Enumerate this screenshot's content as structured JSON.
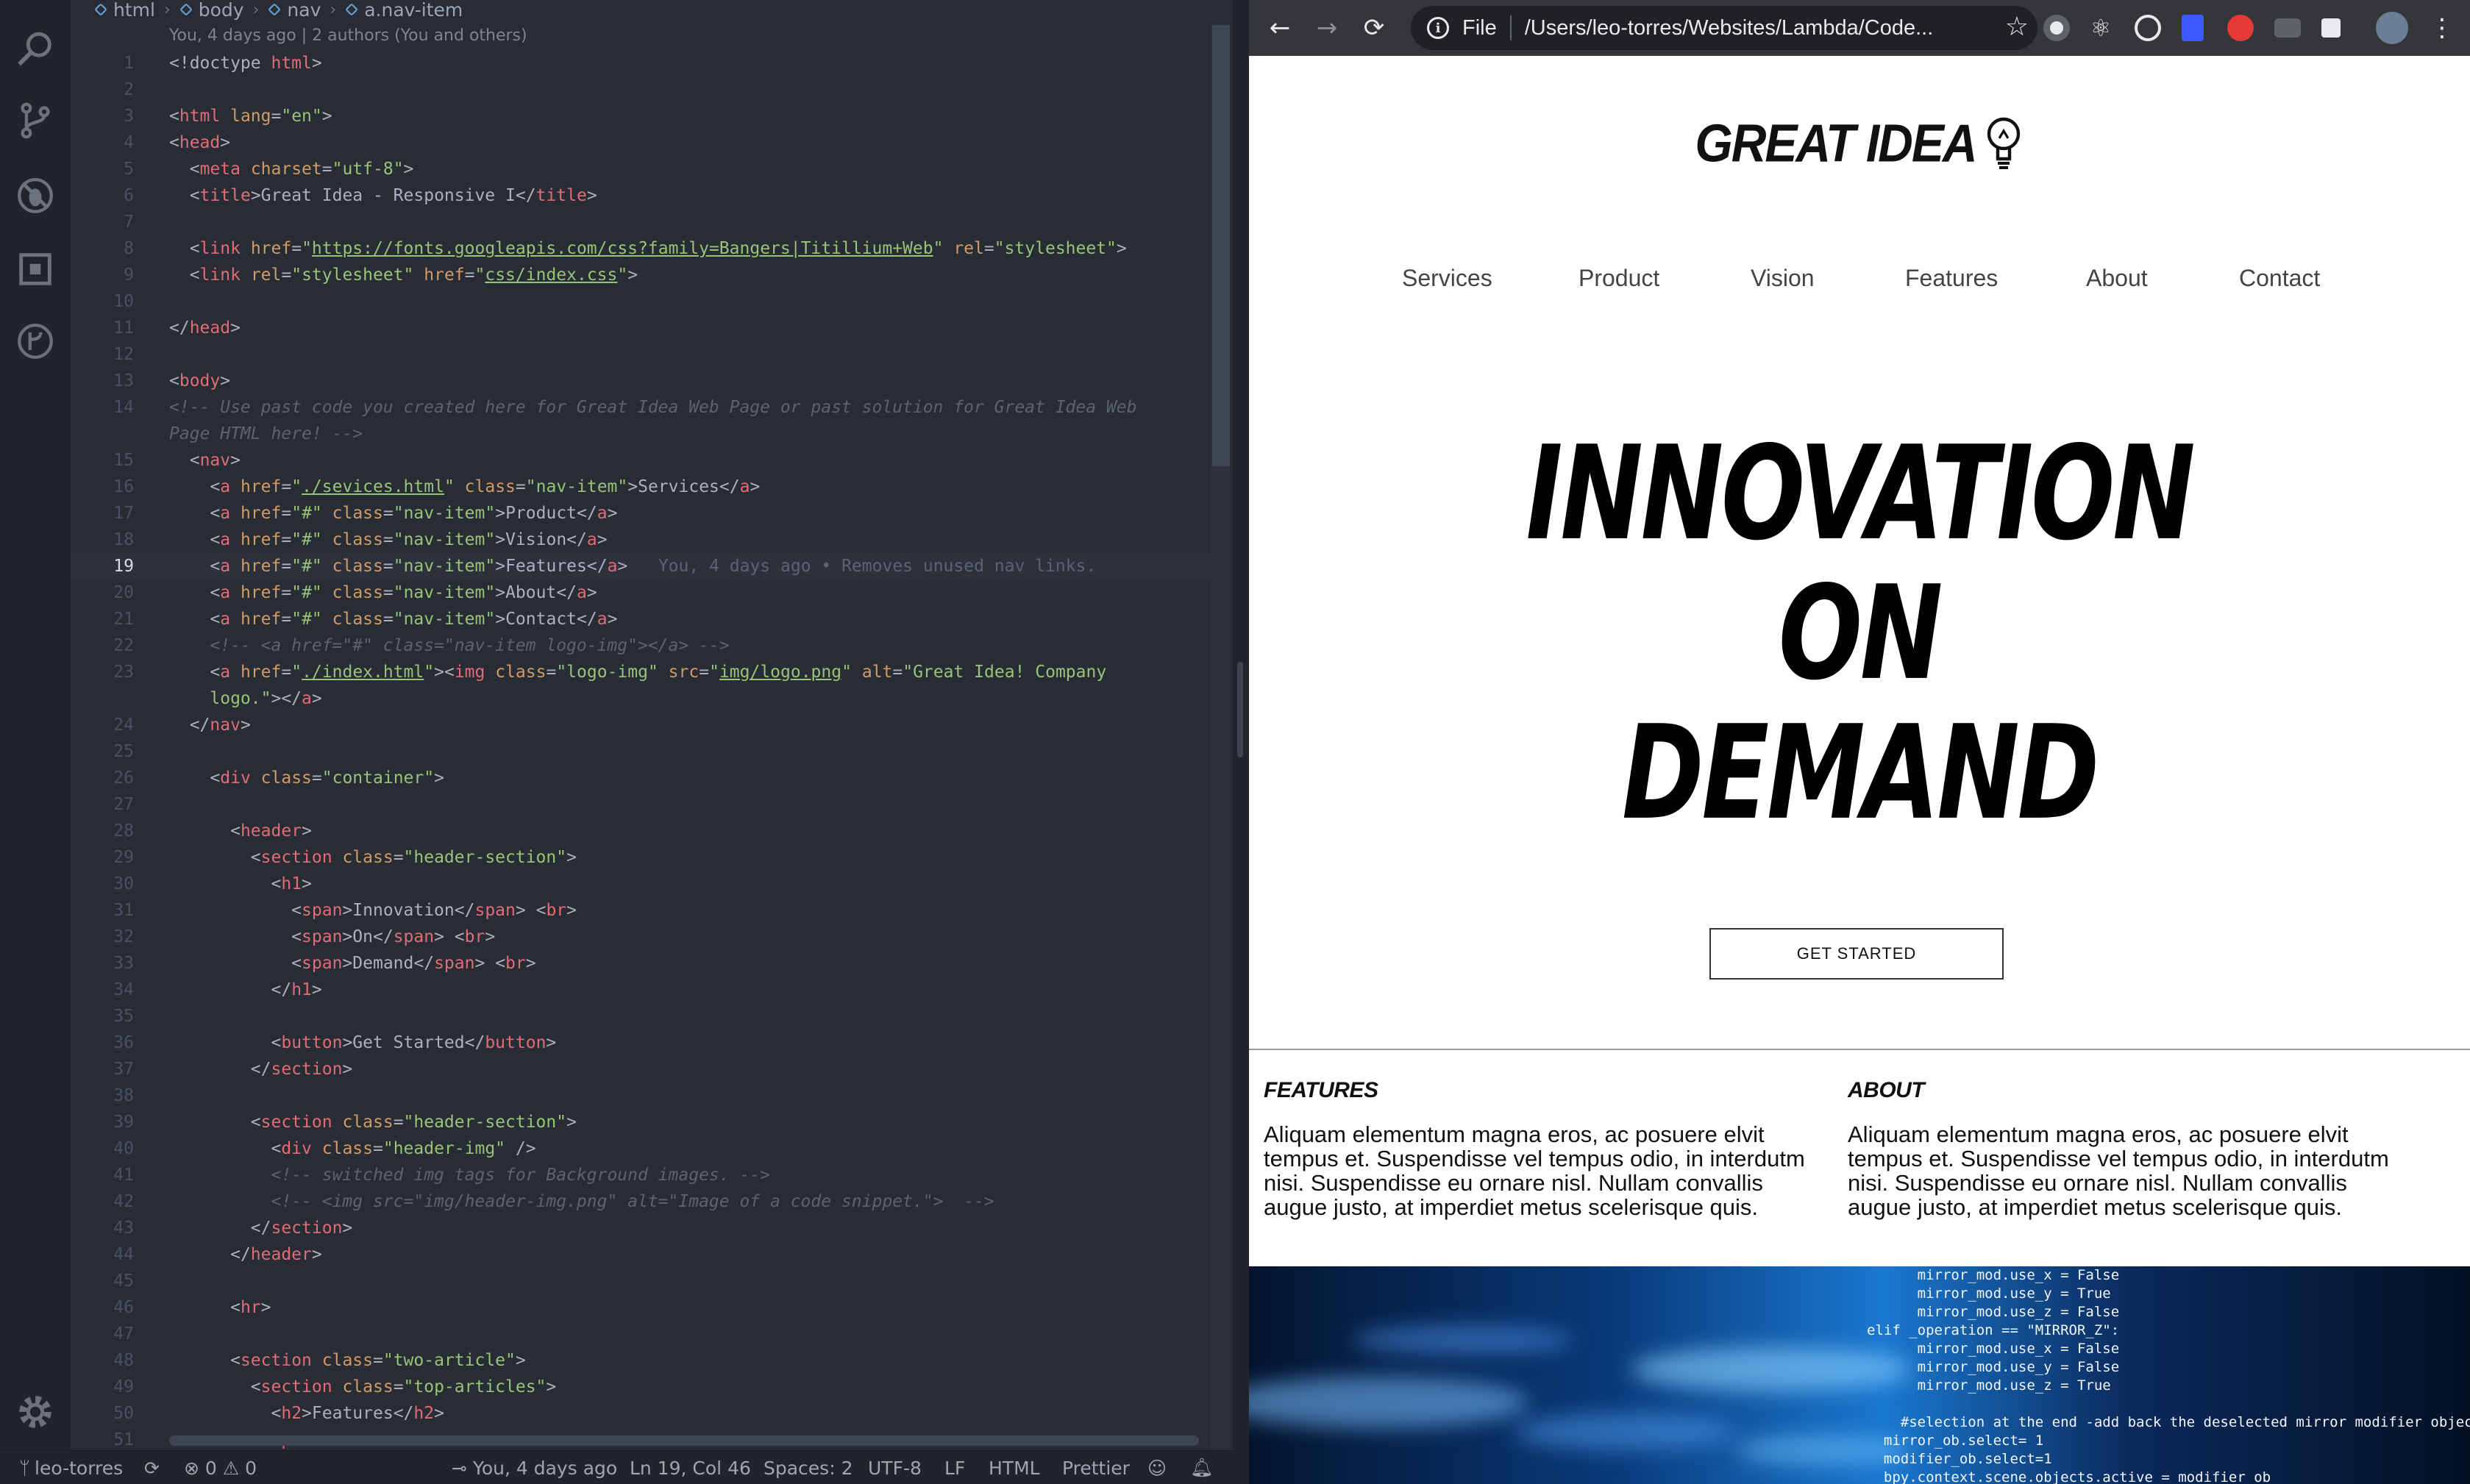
{
  "editor": {
    "breadcrumb": [
      "html",
      "body",
      "nav",
      "a.nav-item"
    ],
    "blame_header": "You, 4 days ago | 2 authors (You and others)",
    "inline_blame": "You, 4 days ago • Removes unused nav links.",
    "current_line": 19,
    "lines": [
      {
        "n": "1",
        "html": "<span class='t-pun'>&lt;!doctype </span><span class='t-tag'>html</span><span class='t-pun'>&gt;</span>"
      },
      {
        "n": "2",
        "html": ""
      },
      {
        "n": "3",
        "html": "<span class='t-pun'>&lt;</span><span class='t-tag'>html</span> <span class='t-attr'>lang</span>=<span class='t-str'>\"en\"</span><span class='t-pun'>&gt;</span>"
      },
      {
        "n": "4",
        "html": "<span class='t-pun'>&lt;</span><span class='t-tag'>head</span><span class='t-pun'>&gt;</span>"
      },
      {
        "n": "5",
        "html": "  <span class='t-pun'>&lt;</span><span class='t-tag'>meta</span> <span class='t-attr'>charset</span>=<span class='t-str'>\"utf-8\"</span><span class='t-pun'>&gt;</span>"
      },
      {
        "n": "6",
        "html": "  <span class='t-pun'>&lt;</span><span class='t-tag'>title</span><span class='t-pun'>&gt;</span>Great Idea - Responsive I<span class='t-pun'>&lt;/</span><span class='t-tag'>title</span><span class='t-pun'>&gt;</span>"
      },
      {
        "n": "7",
        "html": ""
      },
      {
        "n": "8",
        "html": "  <span class='t-pun'>&lt;</span><span class='t-tag'>link</span> <span class='t-attr'>href</span>=<span class='t-str'>\"</span><span class='t-link'>https://fonts.googleapis.com/css?family=Bangers|Titillium+Web</span><span class='t-str'>\"</span> <span class='t-attr'>rel</span>=<span class='t-str'>\"stylesheet\"</span><span class='t-pun'>&gt;</span>"
      },
      {
        "n": "9",
        "html": "  <span class='t-pun'>&lt;</span><span class='t-tag'>link</span> <span class='t-attr'>rel</span>=<span class='t-str'>\"stylesheet\"</span> <span class='t-attr'>href</span>=<span class='t-str'>\"</span><span class='t-link'>css/index.css</span><span class='t-str'>\"</span><span class='t-pun'>&gt;</span>"
      },
      {
        "n": "10",
        "html": ""
      },
      {
        "n": "11",
        "html": "<span class='t-pun'>&lt;/</span><span class='t-tag'>head</span><span class='t-pun'>&gt;</span>"
      },
      {
        "n": "12",
        "html": ""
      },
      {
        "n": "13",
        "html": "<span class='t-pun'>&lt;</span><span class='t-tag'>body</span><span class='t-pun'>&gt;</span>"
      },
      {
        "n": "14",
        "html": "<span class='t-com'>&lt;!-- Use past code you created here for Great Idea Web Page or past solution for Great Idea Web</span>"
      },
      {
        "n": "",
        "html": "<span class='t-com'>Page HTML here! --&gt;</span>"
      },
      {
        "n": "15",
        "html": "  <span class='t-pun'>&lt;</span><span class='t-tag'>nav</span><span class='t-pun'>&gt;</span>"
      },
      {
        "n": "16",
        "html": "    <span class='t-pun'>&lt;</span><span class='t-tag'>a</span> <span class='t-attr'>href</span>=<span class='t-str'>\"</span><span class='t-link'>./sevices.html</span><span class='t-str'>\"</span> <span class='t-attr'>class</span>=<span class='t-str'>\"nav-item\"</span><span class='t-pun'>&gt;</span>Services<span class='t-pun'>&lt;/</span><span class='t-tag'>a</span><span class='t-pun'>&gt;</span>"
      },
      {
        "n": "17",
        "html": "    <span class='t-pun'>&lt;</span><span class='t-tag'>a</span> <span class='t-attr'>href</span>=<span class='t-str'>\"#\"</span> <span class='t-attr'>class</span>=<span class='t-str'>\"nav-item\"</span><span class='t-pun'>&gt;</span>Product<span class='t-pun'>&lt;/</span><span class='t-tag'>a</span><span class='t-pun'>&gt;</span>"
      },
      {
        "n": "18",
        "html": "    <span class='t-pun'>&lt;</span><span class='t-tag'>a</span> <span class='t-attr'>href</span>=<span class='t-str'>\"#\"</span> <span class='t-attr'>class</span>=<span class='t-str'>\"nav-item\"</span><span class='t-pun'>&gt;</span>Vision<span class='t-pun'>&lt;/</span><span class='t-tag'>a</span><span class='t-pun'>&gt;</span>"
      },
      {
        "n": "19",
        "html": "    <span class='t-pun'>&lt;</span><span class='t-tag'>a</span> <span class='t-attr'>href</span>=<span class='t-str'>\"#\"</span> <span class='t-attr'>class</span>=<span class='t-str'>\"nav-item\"</span><span class='t-pun'>&gt;</span>Features<span class='t-pun'>&lt;/</span><span class='t-tag'>a</span><span class='t-pun'>&gt;</span>   <span class='blame-inline'>You, 4 days ago • Removes unused nav links.</span>"
      },
      {
        "n": "20",
        "html": "    <span class='t-pun'>&lt;</span><span class='t-tag'>a</span> <span class='t-attr'>href</span>=<span class='t-str'>\"#\"</span> <span class='t-attr'>class</span>=<span class='t-str'>\"nav-item\"</span><span class='t-pun'>&gt;</span>About<span class='t-pun'>&lt;/</span><span class='t-tag'>a</span><span class='t-pun'>&gt;</span>"
      },
      {
        "n": "21",
        "html": "    <span class='t-pun'>&lt;</span><span class='t-tag'>a</span> <span class='t-attr'>href</span>=<span class='t-str'>\"#\"</span> <span class='t-attr'>class</span>=<span class='t-str'>\"nav-item\"</span><span class='t-pun'>&gt;</span>Contact<span class='t-pun'>&lt;/</span><span class='t-tag'>a</span><span class='t-pun'>&gt;</span>"
      },
      {
        "n": "22",
        "html": "    <span class='t-com'>&lt;!-- &lt;a href=\"#\" class=\"nav-item logo-img\"&gt;&lt;/a&gt; --&gt;</span>"
      },
      {
        "n": "23",
        "html": "    <span class='t-pun'>&lt;</span><span class='t-tag'>a</span> <span class='t-attr'>href</span>=<span class='t-str'>\"</span><span class='t-link'>./index.html</span><span class='t-str'>\"</span><span class='t-pun'>&gt;&lt;</span><span class='t-tag'>img</span> <span class='t-attr'>class</span>=<span class='t-str'>\"logo-img\"</span> <span class='t-attr'>src</span>=<span class='t-str'>\"</span><span class='t-link'>img/logo.png</span><span class='t-str'>\"</span> <span class='t-attr'>alt</span>=<span class='t-str'>\"Great Idea! Company</span>"
      },
      {
        "n": "",
        "html": "    <span class='t-str'>logo.\"</span><span class='t-pun'>&gt;&lt;/</span><span class='t-tag'>a</span><span class='t-pun'>&gt;</span>"
      },
      {
        "n": "24",
        "html": "  <span class='t-pun'>&lt;/</span><span class='t-tag'>nav</span><span class='t-pun'>&gt;</span>"
      },
      {
        "n": "25",
        "html": ""
      },
      {
        "n": "26",
        "html": "    <span class='t-pun'>&lt;</span><span class='t-tag'>div</span> <span class='t-attr'>class</span>=<span class='t-str'>\"container\"</span><span class='t-pun'>&gt;</span>"
      },
      {
        "n": "27",
        "html": ""
      },
      {
        "n": "28",
        "html": "      <span class='t-pun'>&lt;</span><span class='t-tag'>header</span><span class='t-pun'>&gt;</span>"
      },
      {
        "n": "29",
        "html": "        <span class='t-pun'>&lt;</span><span class='t-tag'>section</span> <span class='t-attr'>class</span>=<span class='t-str'>\"header-section\"</span><span class='t-pun'>&gt;</span>"
      },
      {
        "n": "30",
        "html": "          <span class='t-pun'>&lt;</span><span class='t-tag'>h1</span><span class='t-pun'>&gt;</span>"
      },
      {
        "n": "31",
        "html": "            <span class='t-pun'>&lt;</span><span class='t-tag'>span</span><span class='t-pun'>&gt;</span>Innovation<span class='t-pun'>&lt;/</span><span class='t-tag'>span</span><span class='t-pun'>&gt;</span> <span class='t-pun'>&lt;</span><span class='t-tag'>br</span><span class='t-pun'>&gt;</span>"
      },
      {
        "n": "32",
        "html": "            <span class='t-pun'>&lt;</span><span class='t-tag'>span</span><span class='t-pun'>&gt;</span>On<span class='t-pun'>&lt;/</span><span class='t-tag'>span</span><span class='t-pun'>&gt;</span> <span class='t-pun'>&lt;</span><span class='t-tag'>br</span><span class='t-pun'>&gt;</span>"
      },
      {
        "n": "33",
        "html": "            <span class='t-pun'>&lt;</span><span class='t-tag'>span</span><span class='t-pun'>&gt;</span>Demand<span class='t-pun'>&lt;/</span><span class='t-tag'>span</span><span class='t-pun'>&gt;</span> <span class='t-pun'>&lt;</span><span class='t-tag'>br</span><span class='t-pun'>&gt;</span>"
      },
      {
        "n": "34",
        "html": "          <span class='t-pun'>&lt;/</span><span class='t-tag'>h1</span><span class='t-pun'>&gt;</span>"
      },
      {
        "n": "35",
        "html": ""
      },
      {
        "n": "36",
        "html": "          <span class='t-pun'>&lt;</span><span class='t-tag'>button</span><span class='t-pun'>&gt;</span>Get Started<span class='t-pun'>&lt;/</span><span class='t-tag'>button</span><span class='t-pun'>&gt;</span>"
      },
      {
        "n": "37",
        "html": "        <span class='t-pun'>&lt;/</span><span class='t-tag'>section</span><span class='t-pun'>&gt;</span>"
      },
      {
        "n": "38",
        "html": ""
      },
      {
        "n": "39",
        "html": "        <span class='t-pun'>&lt;</span><span class='t-tag'>section</span> <span class='t-attr'>class</span>=<span class='t-str'>\"header-section\"</span><span class='t-pun'>&gt;</span>"
      },
      {
        "n": "40",
        "html": "          <span class='t-pun'>&lt;</span><span class='t-tag'>div</span> <span class='t-attr'>class</span>=<span class='t-str'>\"header-img\"</span> <span class='t-pun'>/&gt;</span>"
      },
      {
        "n": "41",
        "html": "          <span class='t-com'>&lt;!-- switched img tags for Background images. --&gt;</span>"
      },
      {
        "n": "42",
        "html": "          <span class='t-com'>&lt;!-- &lt;img src=\"img/header-img.png\" alt=\"Image of a code snippet.\"&gt;  --&gt;</span>"
      },
      {
        "n": "43",
        "html": "        <span class='t-pun'>&lt;/</span><span class='t-tag'>section</span><span class='t-pun'>&gt;</span>"
      },
      {
        "n": "44",
        "html": "      <span class='t-pun'>&lt;/</span><span class='t-tag'>header</span><span class='t-pun'>&gt;</span>"
      },
      {
        "n": "45",
        "html": ""
      },
      {
        "n": "46",
        "html": "      <span class='t-pun'>&lt;</span><span class='t-tag'>hr</span><span class='t-pun'>&gt;</span>"
      },
      {
        "n": "47",
        "html": ""
      },
      {
        "n": "48",
        "html": "      <span class='t-pun'>&lt;</span><span class='t-tag'>section</span> <span class='t-attr'>class</span>=<span class='t-str'>\"two-article\"</span><span class='t-pun'>&gt;</span>"
      },
      {
        "n": "49",
        "html": "        <span class='t-pun'>&lt;</span><span class='t-tag'>section</span> <span class='t-attr'>class</span>=<span class='t-str'>\"top-articles\"</span><span class='t-pun'>&gt;</span>"
      },
      {
        "n": "50",
        "html": "          <span class='t-pun'>&lt;</span><span class='t-tag'>h2</span><span class='t-pun'>&gt;</span>Features<span class='t-pun'>&lt;/</span><span class='t-tag'>h2</span><span class='t-pun'>&gt;</span>"
      },
      {
        "n": "51",
        "html": "          <span class='t-pun'>&lt;</span><span class='t-tag'>p</span><span class='t-pun'>&gt;</span>"
      }
    ]
  },
  "status_bar": {
    "branch": "leo-torres",
    "errors": "0",
    "warnings": "0",
    "blame": "You, 4 days ago",
    "cursor": "Ln 19, Col 46",
    "spaces": "Spaces: 2",
    "encoding": "UTF-8",
    "eol": "LF",
    "language": "HTML",
    "formatter": "Prettier"
  },
  "browser": {
    "omnibox_scheme": "File",
    "omnibox_url": "/Users/leo-torres/Websites/Lambda/Code..."
  },
  "site": {
    "logo_text": "GREAT IDEA",
    "nav": [
      "Services",
      "Product",
      "Vision",
      "Features",
      "About",
      "Contact"
    ],
    "hero": [
      "Innovation",
      "On",
      "Demand"
    ],
    "cta_label": "GET STARTED",
    "articles": [
      {
        "title": "Features",
        "body": "Aliquam elementum magna eros, ac posuere elvit tempus et. Suspendisse vel tempus odio, in interdutm nisi. Suspendisse eu ornare nisl. Nullam convallis augue justo, at imperdiet metus scelerisque quis."
      },
      {
        "title": "About",
        "body": "Aliquam elementum magna eros, ac posuere elvit tempus et. Suspendisse vel tempus odio, in interdutm nisi. Suspendisse eu ornare nisl. Nullam convallis augue justo, at imperdiet metus scelerisque quis."
      }
    ],
    "code_image_lines": [
      "      mirror_mod.use_x = False",
      "      mirror_mod.use_y = True",
      "      mirror_mod.use_z = False",
      "elif _operation == \"MIRROR_Z\":",
      "      mirror_mod.use_x = False",
      "      mirror_mod.use_y = False",
      "      mirror_mod.use_z = True",
      "",
      "    #selection at the end -add back the deselected mirror modifier object",
      "  mirror_ob.select= 1",
      "  modifier_ob.select=1",
      "  bpy.context.scene.objects.active = modifier_ob"
    ]
  }
}
